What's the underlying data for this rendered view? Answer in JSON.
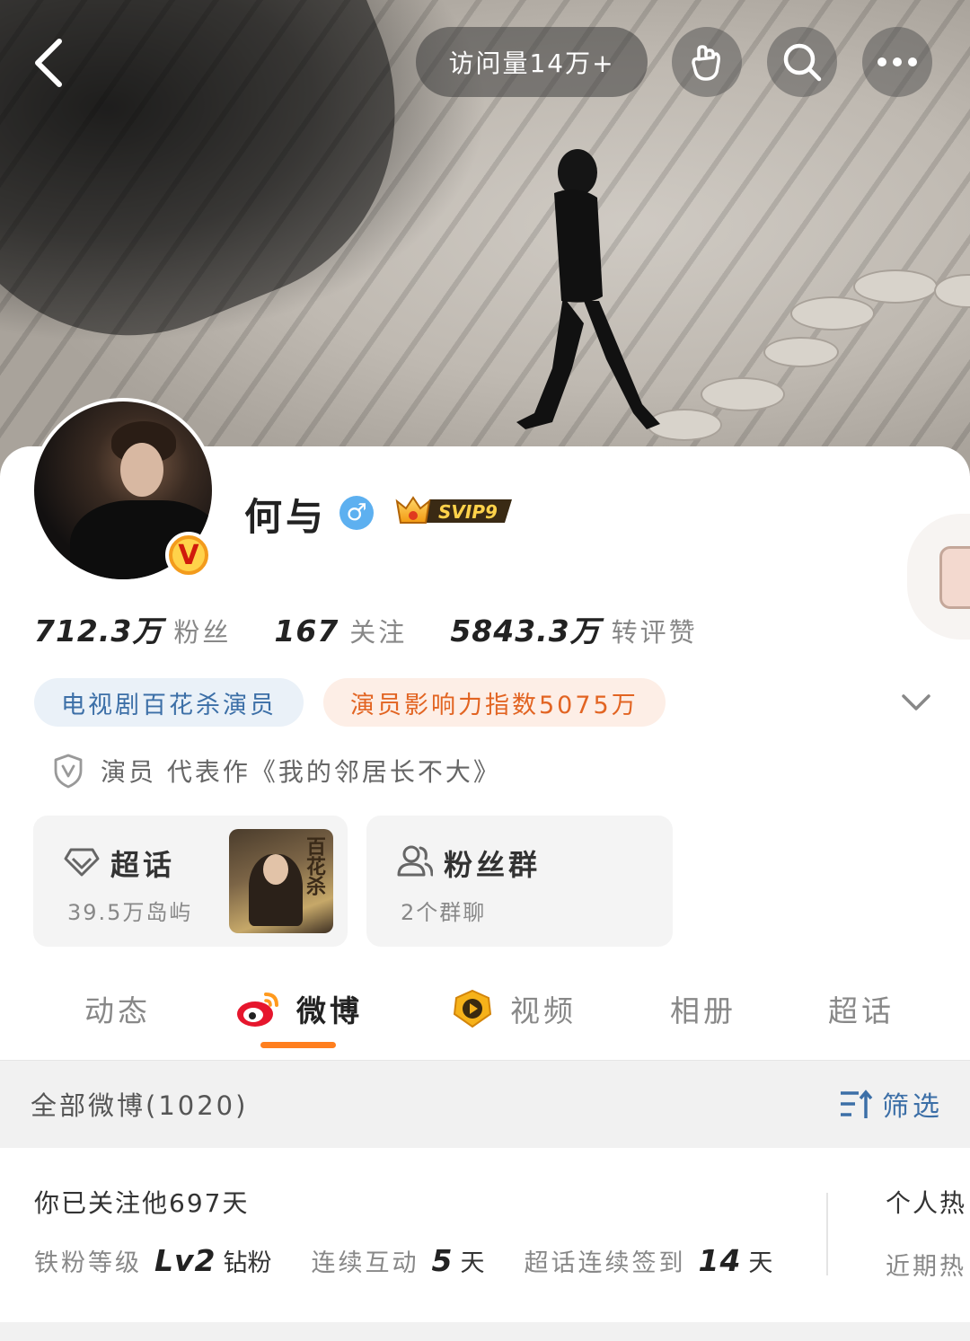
{
  "header": {
    "back_icon": "back-arrow-icon",
    "visits": "访问量14万+",
    "buttons": [
      {
        "icon": "hand-heart-icon"
      },
      {
        "icon": "search-icon"
      },
      {
        "icon": "more-icon"
      }
    ]
  },
  "profile": {
    "name": "何与",
    "gender_symbol": "♂",
    "vip_label": "SVIP9",
    "verified_badge": "V",
    "stats": [
      {
        "value": "712.3万",
        "label": "粉丝"
      },
      {
        "value": "167",
        "label": "关注"
      },
      {
        "value": "5843.3万",
        "label": "转评赞"
      }
    ],
    "tags": [
      {
        "text": "电视剧百花杀演员",
        "color": "#3c6fa7"
      },
      {
        "text": "演员影响力指数5075万",
        "color": "#e26422"
      }
    ],
    "certification": "演员 代表作《我的邻居长不大》"
  },
  "cards": {
    "supertopic": {
      "title": "超话",
      "subtitle": "39.5万岛屿",
      "poster_text": "百花杀"
    },
    "fan_group": {
      "title": "粉丝群",
      "subtitle": "2个群聊"
    }
  },
  "tabs": [
    {
      "label": "动态",
      "active": false
    },
    {
      "label": "微博",
      "active": true
    },
    {
      "label": "视频",
      "active": false
    },
    {
      "label": "相册",
      "active": false
    },
    {
      "label": "超话",
      "active": false
    }
  ],
  "feed": {
    "all_label": "全部微博(1020)",
    "filter_label": "筛选"
  },
  "fan_info": {
    "follow_days": "你已关注他697天",
    "level_label": "铁粉等级",
    "level_value": "Lv2",
    "level_unit": "钻粉",
    "interact_label": "连续互动",
    "interact_value": "5",
    "interact_unit": "天",
    "signin_label": "超话连续签到",
    "signin_value": "14",
    "signin_unit": "天",
    "right_title": "个人热",
    "right_sub": "近期热"
  },
  "colors": {
    "accent_orange": "#ff7f1e",
    "link_blue": "#3c6fa7"
  }
}
